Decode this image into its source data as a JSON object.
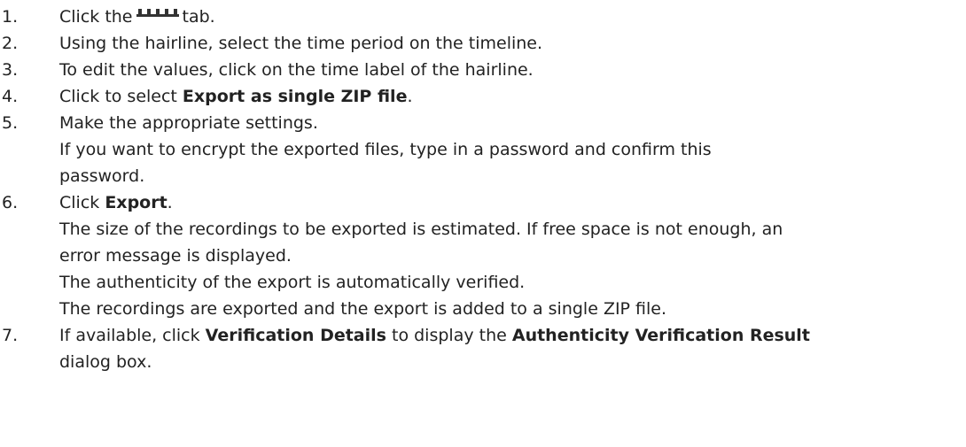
{
  "steps": [
    {
      "number": "1.",
      "pre": "Click the",
      "icon": "timeline-tab-icon",
      "post": "tab."
    },
    {
      "number": "2.",
      "text": "Using the hairline, select the time period on the timeline."
    },
    {
      "number": "3.",
      "text": "To edit the values, click on the time label of the hairline."
    },
    {
      "number": "4.",
      "pre": "Click to select ",
      "bold": "Export as single ZIP file",
      "post": "."
    },
    {
      "number": "5.",
      "text": "Make the appropriate settings.",
      "note_line1": "If you want to encrypt the exported files, type in a password and confirm this",
      "note_line2": "password."
    },
    {
      "number": "6.",
      "pre": "Click ",
      "bold": "Export",
      "post": ".",
      "note1_line1": "The size of the recordings to be exported is estimated. If free space is not enough, an",
      "note1_line2": "error message is displayed.",
      "note2": "The authenticity of the export is automatically verified.",
      "note3": "The recordings are exported and the export is added to a single ZIP file."
    },
    {
      "number": "7.",
      "pre": "If available, click ",
      "bold1": "Verification Details",
      "mid": " to display the ",
      "bold2": "Authenticity Verification Result",
      "line2": "dialog box."
    }
  ]
}
